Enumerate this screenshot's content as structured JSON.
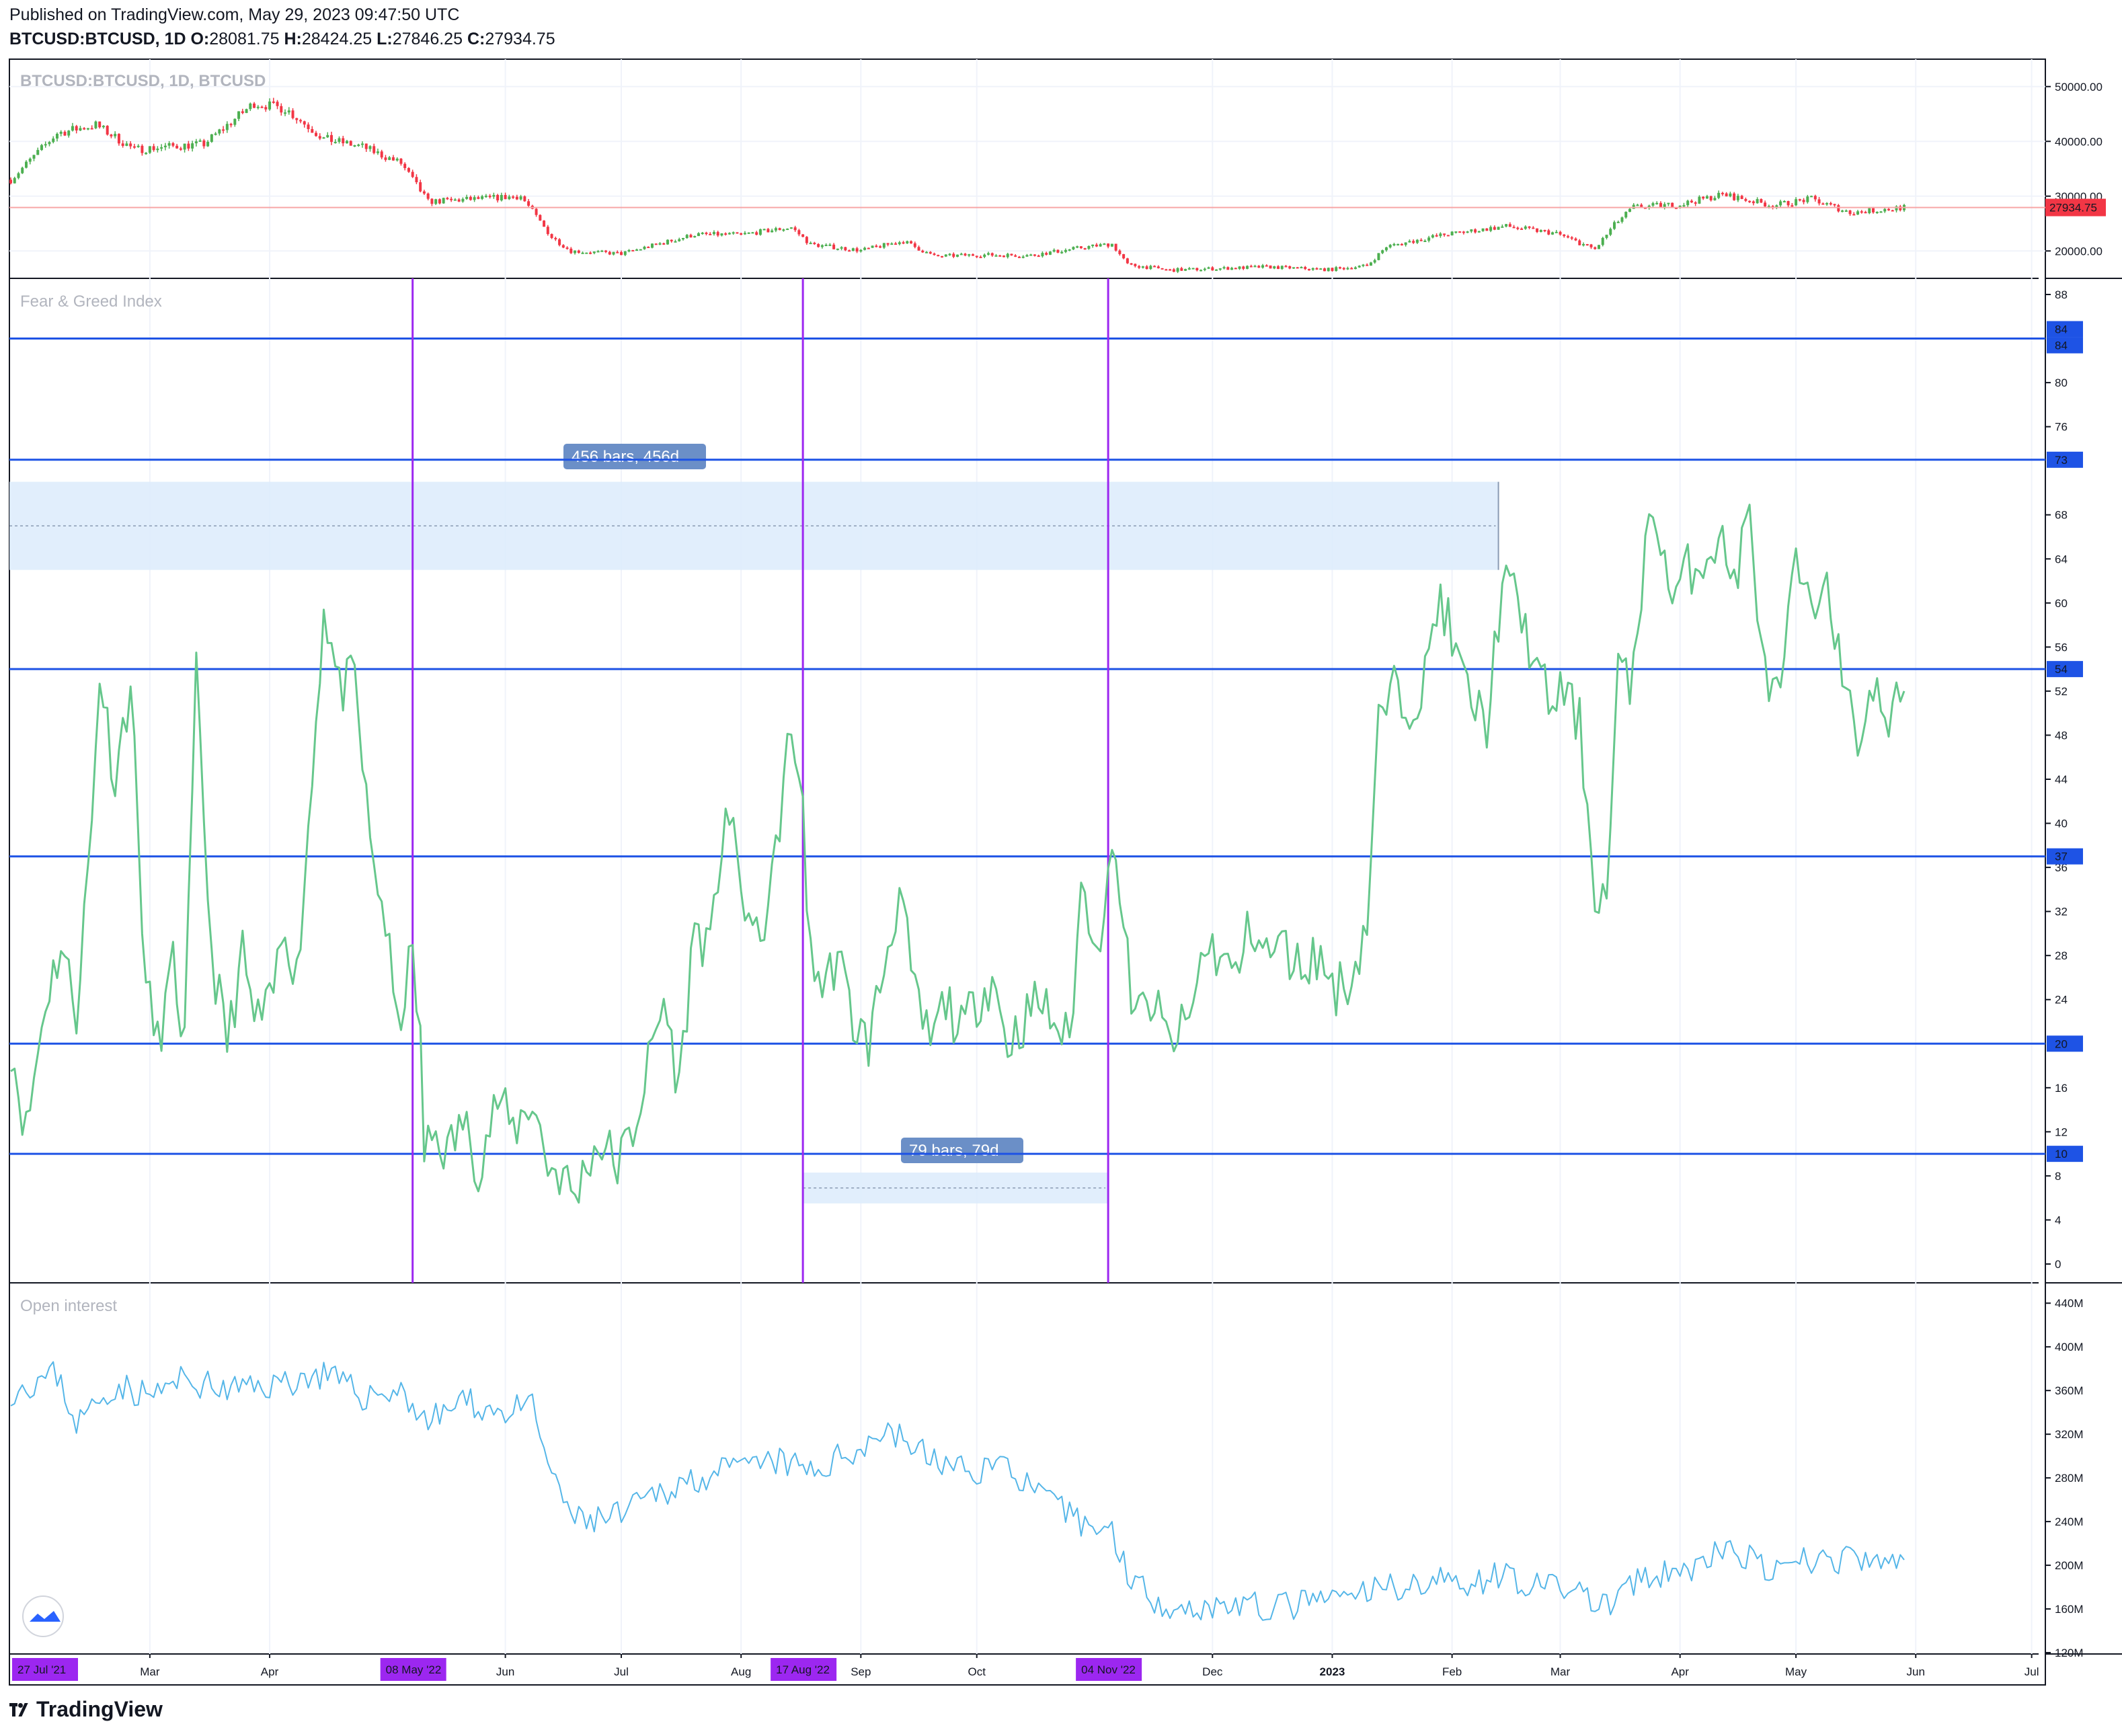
{
  "header": {
    "published": "Published on TradingView.com, May 29, 2023 09:47:50 UTC",
    "symbol": "BTCUSD:BTCUSD, 1D",
    "o_label": "O:",
    "o": "28081.75",
    "h_label": "H:",
    "h": "28424.25",
    "l_label": "L:",
    "l": "27846.25",
    "c_label": "C:",
    "c": "27934.75"
  },
  "footer": {
    "brand": "TradingView"
  },
  "colors": {
    "up": "#4caf50",
    "down": "#f23645",
    "fng_line": "#66c78c",
    "oi_line": "#55b6e8",
    "hline": "#1e53e5",
    "vline": "#9c27f0",
    "measure_fill": "#dcebfc",
    "measure_label": "#6b8fc7",
    "last_price": "#f23645"
  },
  "chart_data": [
    {
      "type": "candlestick",
      "title": "BTCUSD:BTCUSD, 1D, BTCUSD",
      "ylim": [
        15000,
        55000
      ],
      "y_ticks": [
        "50000.00",
        "40000.00",
        "30000.00",
        "20000.00"
      ],
      "y_tick_values": [
        50000,
        40000,
        30000,
        20000
      ],
      "last_price": "27934.75",
      "last_value": 27934.75,
      "close_series": {
        "start_date": "2022-01-24",
        "end_date": "2023-05-29",
        "points": [
          [
            "2022-01-24",
            33000
          ],
          [
            "2022-02-05",
            41500
          ],
          [
            "2022-02-15",
            43000
          ],
          [
            "2022-02-25",
            38500
          ],
          [
            "2022-03-05",
            39000
          ],
          [
            "2022-03-15",
            39500
          ],
          [
            "2022-03-28",
            47000
          ],
          [
            "2022-04-05",
            46000
          ],
          [
            "2022-04-15",
            40500
          ],
          [
            "2022-04-25",
            39000
          ],
          [
            "2022-05-05",
            36000
          ],
          [
            "2022-05-12",
            29000
          ],
          [
            "2022-05-25",
            29500
          ],
          [
            "2022-06-05",
            30000
          ],
          [
            "2022-06-13",
            22500
          ],
          [
            "2022-06-18",
            20000
          ],
          [
            "2022-07-01",
            19500
          ],
          [
            "2022-07-20",
            23000
          ],
          [
            "2022-08-01",
            23000
          ],
          [
            "2022-08-14",
            24300
          ],
          [
            "2022-08-19",
            21200
          ],
          [
            "2022-09-01",
            20100
          ],
          [
            "2022-09-12",
            21800
          ],
          [
            "2022-09-20",
            19000
          ],
          [
            "2022-10-01",
            19300
          ],
          [
            "2022-10-15",
            19200
          ],
          [
            "2022-10-28",
            20600
          ],
          [
            "2022-11-05",
            21300
          ],
          [
            "2022-11-09",
            17500
          ],
          [
            "2022-11-20",
            16500
          ],
          [
            "2022-12-15",
            17100
          ],
          [
            "2022-12-31",
            16600
          ],
          [
            "2023-01-10",
            17300
          ],
          [
            "2023-01-15",
            20800
          ],
          [
            "2023-01-30",
            23000
          ],
          [
            "2023-02-15",
            24500
          ],
          [
            "2023-02-28",
            23200
          ],
          [
            "2023-03-10",
            20300
          ],
          [
            "2023-03-15",
            24800
          ],
          [
            "2023-03-20",
            28000
          ],
          [
            "2023-04-01",
            28500
          ],
          [
            "2023-04-12",
            30300
          ],
          [
            "2023-04-25",
            28300
          ],
          [
            "2023-05-05",
            29500
          ],
          [
            "2023-05-15",
            27000
          ],
          [
            "2023-05-29",
            27934.75
          ]
        ]
      }
    },
    {
      "type": "line",
      "title": "Fear & Greed Index",
      "ylim": [
        0,
        88
      ],
      "y_ticks": [
        88,
        80,
        76,
        68,
        64,
        60,
        56,
        52,
        48,
        44,
        40,
        36,
        32,
        28,
        24,
        16,
        12,
        8,
        4,
        0
      ],
      "horizontal_lines": [
        84,
        73,
        54,
        37,
        20,
        10
      ],
      "horizontal_line_labels": [
        "84",
        "84",
        "73",
        "54",
        "37",
        "20",
        "10"
      ],
      "vertical_lines": [
        "08 May '22",
        "17 Aug '22",
        "04 Nov '22"
      ],
      "measures": [
        {
          "label": "456 bars, 456d",
          "from": "2021-07-27",
          "to": "2023-02-13",
          "y_range": [
            63,
            71
          ]
        },
        {
          "label": "79 bars, 79d",
          "from": "2022-08-17",
          "to": "2022-11-04",
          "y_range": [
            5.5,
            8.3
          ]
        }
      ],
      "series": {
        "start_date": "2022-01-24",
        "points": [
          [
            "2022-01-24",
            20
          ],
          [
            "2022-01-28",
            12
          ],
          [
            "2022-02-02",
            24
          ],
          [
            "2022-02-06",
            29
          ],
          [
            "2022-02-10",
            23
          ],
          [
            "2022-02-14",
            40
          ],
          [
            "2022-02-16",
            54
          ],
          [
            "2022-02-20",
            44
          ],
          [
            "2022-02-24",
            53
          ],
          [
            "2022-02-28",
            25
          ],
          [
            "2022-03-03",
            20
          ],
          [
            "2022-03-07",
            27
          ],
          [
            "2022-03-10",
            20
          ],
          [
            "2022-03-13",
            53
          ],
          [
            "2022-03-17",
            28
          ],
          [
            "2022-03-21",
            20
          ],
          [
            "2022-03-25",
            28
          ],
          [
            "2022-03-28",
            22
          ],
          [
            "2022-04-01",
            23
          ],
          [
            "2022-04-05",
            31
          ],
          [
            "2022-04-08",
            26
          ],
          [
            "2022-04-12",
            44
          ],
          [
            "2022-04-15",
            60
          ],
          [
            "2022-04-19",
            52
          ],
          [
            "2022-04-23",
            53
          ],
          [
            "2022-04-27",
            38
          ],
          [
            "2022-05-01",
            31
          ],
          [
            "2022-05-04",
            21
          ],
          [
            "2022-05-06",
            25
          ],
          [
            "2022-05-08",
            28
          ],
          [
            "2022-05-10",
            20
          ],
          [
            "2022-05-11",
            10
          ],
          [
            "2022-05-14",
            12
          ],
          [
            "2022-05-17",
            10
          ],
          [
            "2022-05-21",
            13
          ],
          [
            "2022-05-25",
            9
          ],
          [
            "2022-05-30",
            15
          ],
          [
            "2022-06-03",
            12
          ],
          [
            "2022-06-08",
            15
          ],
          [
            "2022-06-12",
            9
          ],
          [
            "2022-06-16",
            8
          ],
          [
            "2022-06-19",
            6
          ],
          [
            "2022-06-23",
            10
          ],
          [
            "2022-06-26",
            11
          ],
          [
            "2022-06-30",
            9
          ],
          [
            "2022-07-04",
            12
          ],
          [
            "2022-07-08",
            18
          ],
          [
            "2022-07-12",
            24
          ],
          [
            "2022-07-16",
            16
          ],
          [
            "2022-07-20",
            31
          ],
          [
            "2022-07-24",
            28
          ],
          [
            "2022-07-28",
            42
          ],
          [
            "2022-08-01",
            34
          ],
          [
            "2022-08-05",
            29
          ],
          [
            "2022-08-09",
            34
          ],
          [
            "2022-08-13",
            47
          ],
          [
            "2022-08-17",
            44
          ],
          [
            "2022-08-18",
            30
          ],
          [
            "2022-08-22",
            25
          ],
          [
            "2022-08-26",
            28
          ],
          [
            "2022-08-30",
            22
          ],
          [
            "2022-09-03",
            20
          ],
          [
            "2022-09-07",
            27
          ],
          [
            "2022-09-11",
            34
          ],
          [
            "2022-09-15",
            24
          ],
          [
            "2022-09-19",
            20
          ],
          [
            "2022-09-23",
            24
          ],
          [
            "2022-09-27",
            21
          ],
          [
            "2022-10-01",
            24
          ],
          [
            "2022-10-05",
            26
          ],
          [
            "2022-10-09",
            20
          ],
          [
            "2022-10-13",
            22
          ],
          [
            "2022-10-17",
            24
          ],
          [
            "2022-10-21",
            22
          ],
          [
            "2022-10-25",
            20
          ],
          [
            "2022-10-28",
            34
          ],
          [
            "2022-10-31",
            31
          ],
          [
            "2022-11-03",
            30
          ],
          [
            "2022-11-04",
            35
          ],
          [
            "2022-11-05",
            40
          ],
          [
            "2022-11-08",
            30
          ],
          [
            "2022-11-11",
            22
          ],
          [
            "2022-11-15",
            24
          ],
          [
            "2022-11-20",
            20
          ],
          [
            "2022-11-25",
            22
          ],
          [
            "2022-11-29",
            29
          ],
          [
            "2022-12-03",
            28
          ],
          [
            "2022-12-07",
            26
          ],
          [
            "2022-12-11",
            31
          ],
          [
            "2022-12-15",
            28
          ],
          [
            "2022-12-19",
            29
          ],
          [
            "2022-12-23",
            27
          ],
          [
            "2022-12-28",
            28
          ],
          [
            "2023-01-02",
            25
          ],
          [
            "2023-01-06",
            26
          ],
          [
            "2023-01-10",
            31
          ],
          [
            "2023-01-13",
            49
          ],
          [
            "2023-01-17",
            52
          ],
          [
            "2023-01-21",
            51
          ],
          [
            "2023-01-25",
            53
          ],
          [
            "2023-01-29",
            61
          ],
          [
            "2023-02-02",
            55
          ],
          [
            "2023-02-06",
            51
          ],
          [
            "2023-02-10",
            49
          ],
          [
            "2023-02-14",
            62
          ],
          [
            "2023-02-18",
            60
          ],
          [
            "2023-02-22",
            55
          ],
          [
            "2023-02-26",
            51
          ],
          [
            "2023-03-02",
            52
          ],
          [
            "2023-03-06",
            49
          ],
          [
            "2023-03-10",
            34
          ],
          [
            "2023-03-13",
            33
          ],
          [
            "2023-03-16",
            54
          ],
          [
            "2023-03-19",
            52
          ],
          [
            "2023-03-23",
            65
          ],
          [
            "2023-03-26",
            68
          ],
          [
            "2023-03-30",
            60
          ],
          [
            "2023-04-03",
            63
          ],
          [
            "2023-04-07",
            64
          ],
          [
            "2023-04-11",
            66
          ],
          [
            "2023-04-15",
            62
          ],
          [
            "2023-04-19",
            68
          ],
          [
            "2023-04-23",
            53
          ],
          [
            "2023-04-27",
            51
          ],
          [
            "2023-05-01",
            64
          ],
          [
            "2023-05-05",
            58
          ],
          [
            "2023-05-09",
            64
          ],
          [
            "2023-05-13",
            52
          ],
          [
            "2023-05-17",
            48
          ],
          [
            "2023-05-21",
            52
          ],
          [
            "2023-05-25",
            49
          ],
          [
            "2023-05-29",
            52
          ]
        ]
      }
    },
    {
      "type": "line",
      "title": "Open interest",
      "ylim": [
        120,
        450
      ],
      "y_ticks": [
        "440M",
        "400M",
        "360M",
        "320M",
        "280M",
        "240M",
        "200M",
        "160M",
        "120M"
      ],
      "y_tick_values": [
        440,
        400,
        360,
        320,
        280,
        240,
        200,
        160,
        120
      ],
      "series": {
        "start_date": "2022-01-24",
        "points": [
          [
            "2022-01-24",
            360
          ],
          [
            "2022-02-05",
            375
          ],
          [
            "2022-02-10",
            330
          ],
          [
            "2022-02-20",
            365
          ],
          [
            "2022-03-01",
            355
          ],
          [
            "2022-03-10",
            370
          ],
          [
            "2022-03-20",
            360
          ],
          [
            "2022-04-01",
            365
          ],
          [
            "2022-04-15",
            375
          ],
          [
            "2022-04-25",
            355
          ],
          [
            "2022-05-05",
            360
          ],
          [
            "2022-05-12",
            330
          ],
          [
            "2022-05-20",
            350
          ],
          [
            "2022-06-01",
            340
          ],
          [
            "2022-06-08",
            345
          ],
          [
            "2022-06-14",
            270
          ],
          [
            "2022-06-20",
            240
          ],
          [
            "2022-07-01",
            245
          ],
          [
            "2022-07-10",
            265
          ],
          [
            "2022-07-20",
            280
          ],
          [
            "2022-08-01",
            288
          ],
          [
            "2022-08-10",
            295
          ],
          [
            "2022-08-20",
            285
          ],
          [
            "2022-08-30",
            305
          ],
          [
            "2022-09-08",
            325
          ],
          [
            "2022-09-18",
            300
          ],
          [
            "2022-09-28",
            285
          ],
          [
            "2022-10-08",
            295
          ],
          [
            "2022-10-18",
            260
          ],
          [
            "2022-10-28",
            240
          ],
          [
            "2022-11-05",
            230
          ],
          [
            "2022-11-09",
            195
          ],
          [
            "2022-11-15",
            170
          ],
          [
            "2022-11-25",
            160
          ],
          [
            "2022-12-05",
            165
          ],
          [
            "2022-12-15",
            160
          ],
          [
            "2022-12-25",
            165
          ],
          [
            "2023-01-05",
            170
          ],
          [
            "2023-01-15",
            180
          ],
          [
            "2023-01-25",
            185
          ],
          [
            "2023-02-05",
            185
          ],
          [
            "2023-02-15",
            192
          ],
          [
            "2023-02-25",
            178
          ],
          [
            "2023-03-05",
            180
          ],
          [
            "2023-03-12",
            160
          ],
          [
            "2023-03-18",
            180
          ],
          [
            "2023-03-28",
            190
          ],
          [
            "2023-04-05",
            200
          ],
          [
            "2023-04-15",
            215
          ],
          [
            "2023-04-25",
            190
          ],
          [
            "2023-05-01",
            200
          ],
          [
            "2023-05-05",
            205
          ],
          [
            "2023-05-15",
            205
          ],
          [
            "2023-05-22",
            200
          ],
          [
            "2023-05-29",
            205
          ]
        ]
      }
    }
  ],
  "x_axis": {
    "labels": [
      "Mar",
      "Apr",
      "Jun",
      "Jul",
      "Aug",
      "Sep",
      "Oct",
      "Dec",
      "2023",
      "Feb",
      "Mar",
      "Apr",
      "May",
      "Jun",
      "Jul"
    ],
    "label_dates": [
      "2022-03-01",
      "2022-04-01",
      "2022-06-01",
      "2022-07-01",
      "2022-08-01",
      "2022-09-01",
      "2022-10-01",
      "2022-12-01",
      "2023-01-01",
      "2023-02-01",
      "2023-03-01",
      "2023-04-01",
      "2023-05-01",
      "2023-06-01",
      "2023-07-01"
    ],
    "highlighted": [
      {
        "label": "27 Jul '21",
        "date": "2022-01-24"
      },
      {
        "label": "08 May '22",
        "date": "2022-05-08"
      },
      {
        "label": "17 Aug '22",
        "date": "2022-08-17"
      },
      {
        "label": "04 Nov '22",
        "date": "2022-11-04"
      }
    ]
  }
}
